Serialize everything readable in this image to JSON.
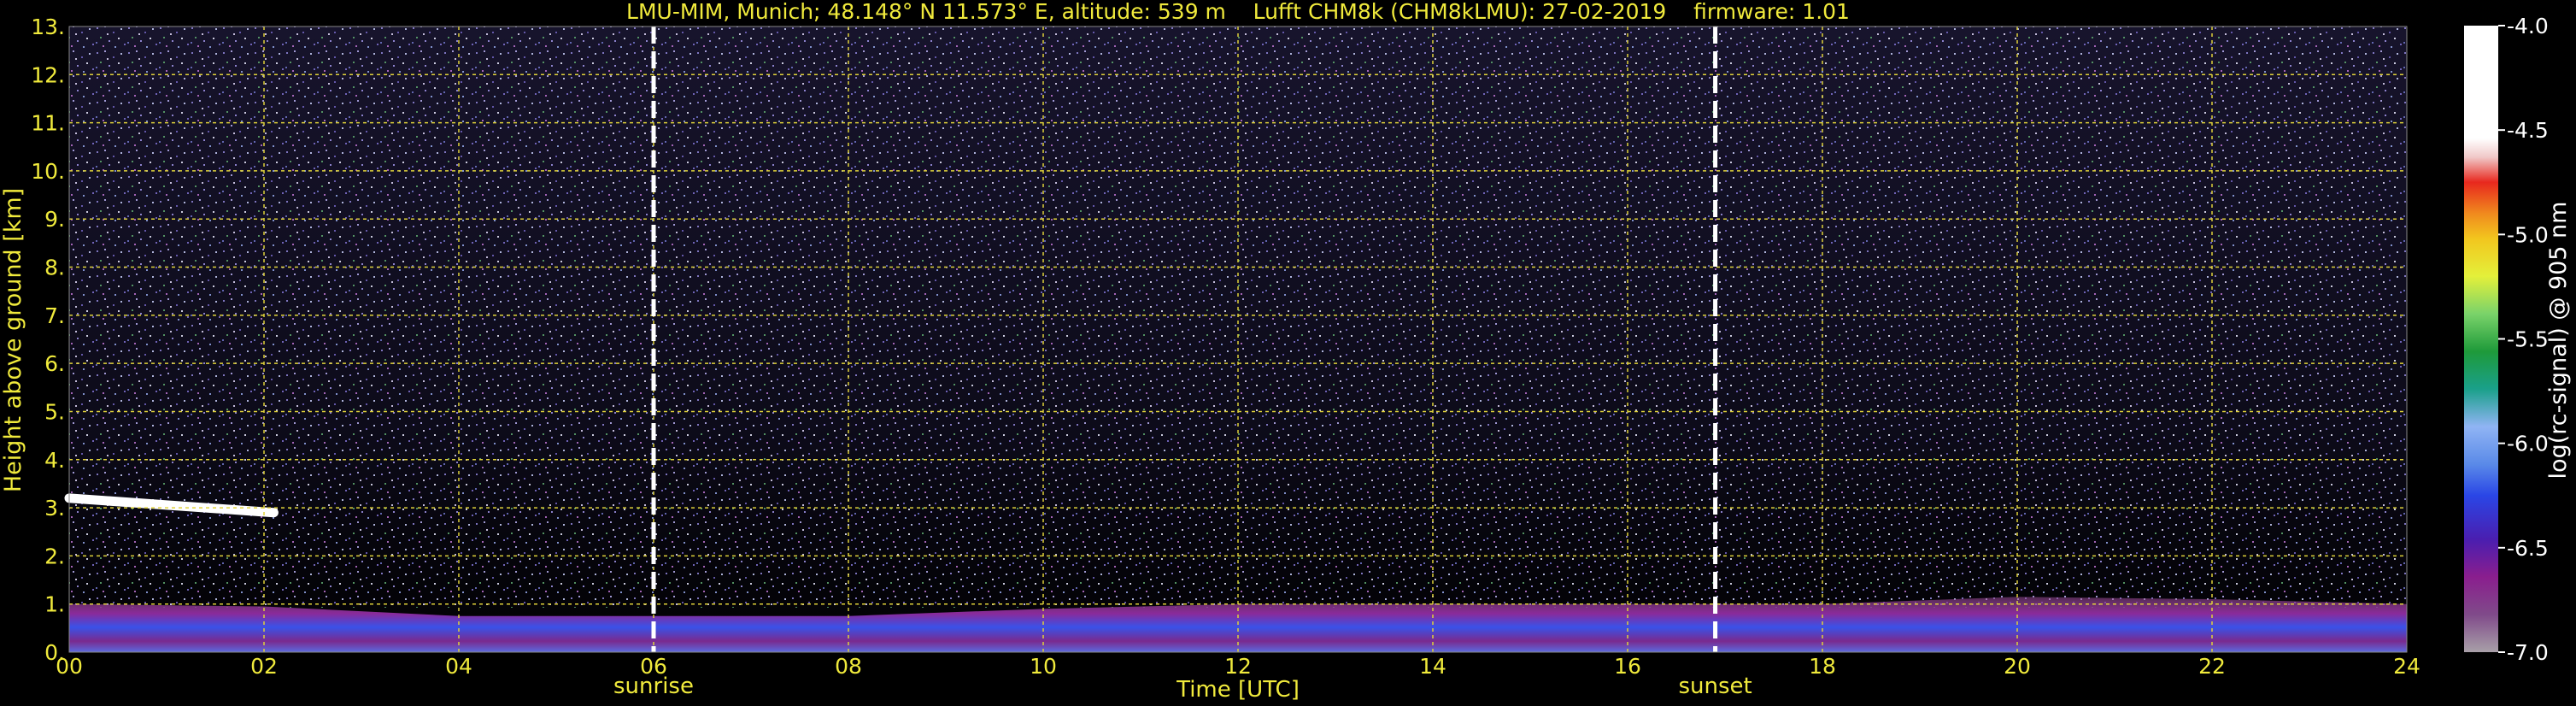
{
  "chart_data": {
    "type": "heatmap",
    "title": "LMU-MIM, Munich; 48.148° N 11.573° E, altitude: 539 m    Lufft CHM8k (CHM8kLMU): 27-02-2019    firmware: 1.01",
    "xlabel": "Time [UTC]",
    "ylabel": "Height above ground [km]",
    "colorbar_label": "log(rc-signal) @ 905 nm",
    "xlim": [
      0,
      24
    ],
    "ylim": [
      0,
      13
    ],
    "x_ticks": [
      "00",
      "02",
      "04",
      "06",
      "08",
      "10",
      "12",
      "14",
      "16",
      "18",
      "20",
      "22",
      "24"
    ],
    "y_ticks": [
      "0.",
      "1.",
      "2.",
      "3.",
      "4.",
      "5.",
      "6.",
      "7.",
      "8.",
      "9.",
      "10.",
      "11.",
      "12.",
      "13."
    ],
    "grid": true,
    "colorbar_range": [
      -7.0,
      -4.0
    ],
    "colorbar_ticks": [
      "-4.0",
      "-4.5",
      "-5.0",
      "-5.5",
      "-6.0",
      "-6.5",
      "-7.0"
    ],
    "annotations": [
      {
        "text": "sunrise",
        "x": 6.0
      },
      {
        "text": "sunset",
        "x": 16.9
      }
    ],
    "features": [
      {
        "name": "cloud-layer",
        "x": [
          0.0,
          2.1
        ],
        "y": [
          3.2,
          2.9
        ]
      },
      {
        "name": "boundary-layer",
        "x": [
          0,
          24
        ],
        "y_top": [
          1.0,
          0.95,
          0.75,
          0.75,
          0.75,
          0.9,
          1.0,
          1.0,
          1.0,
          1.0,
          1.15,
          1.1,
          1.0
        ]
      }
    ]
  },
  "colors": {
    "text": "#f0ea3c",
    "grid": "#e0d23a",
    "background": "#000000",
    "marker_line": "#ffffff"
  }
}
